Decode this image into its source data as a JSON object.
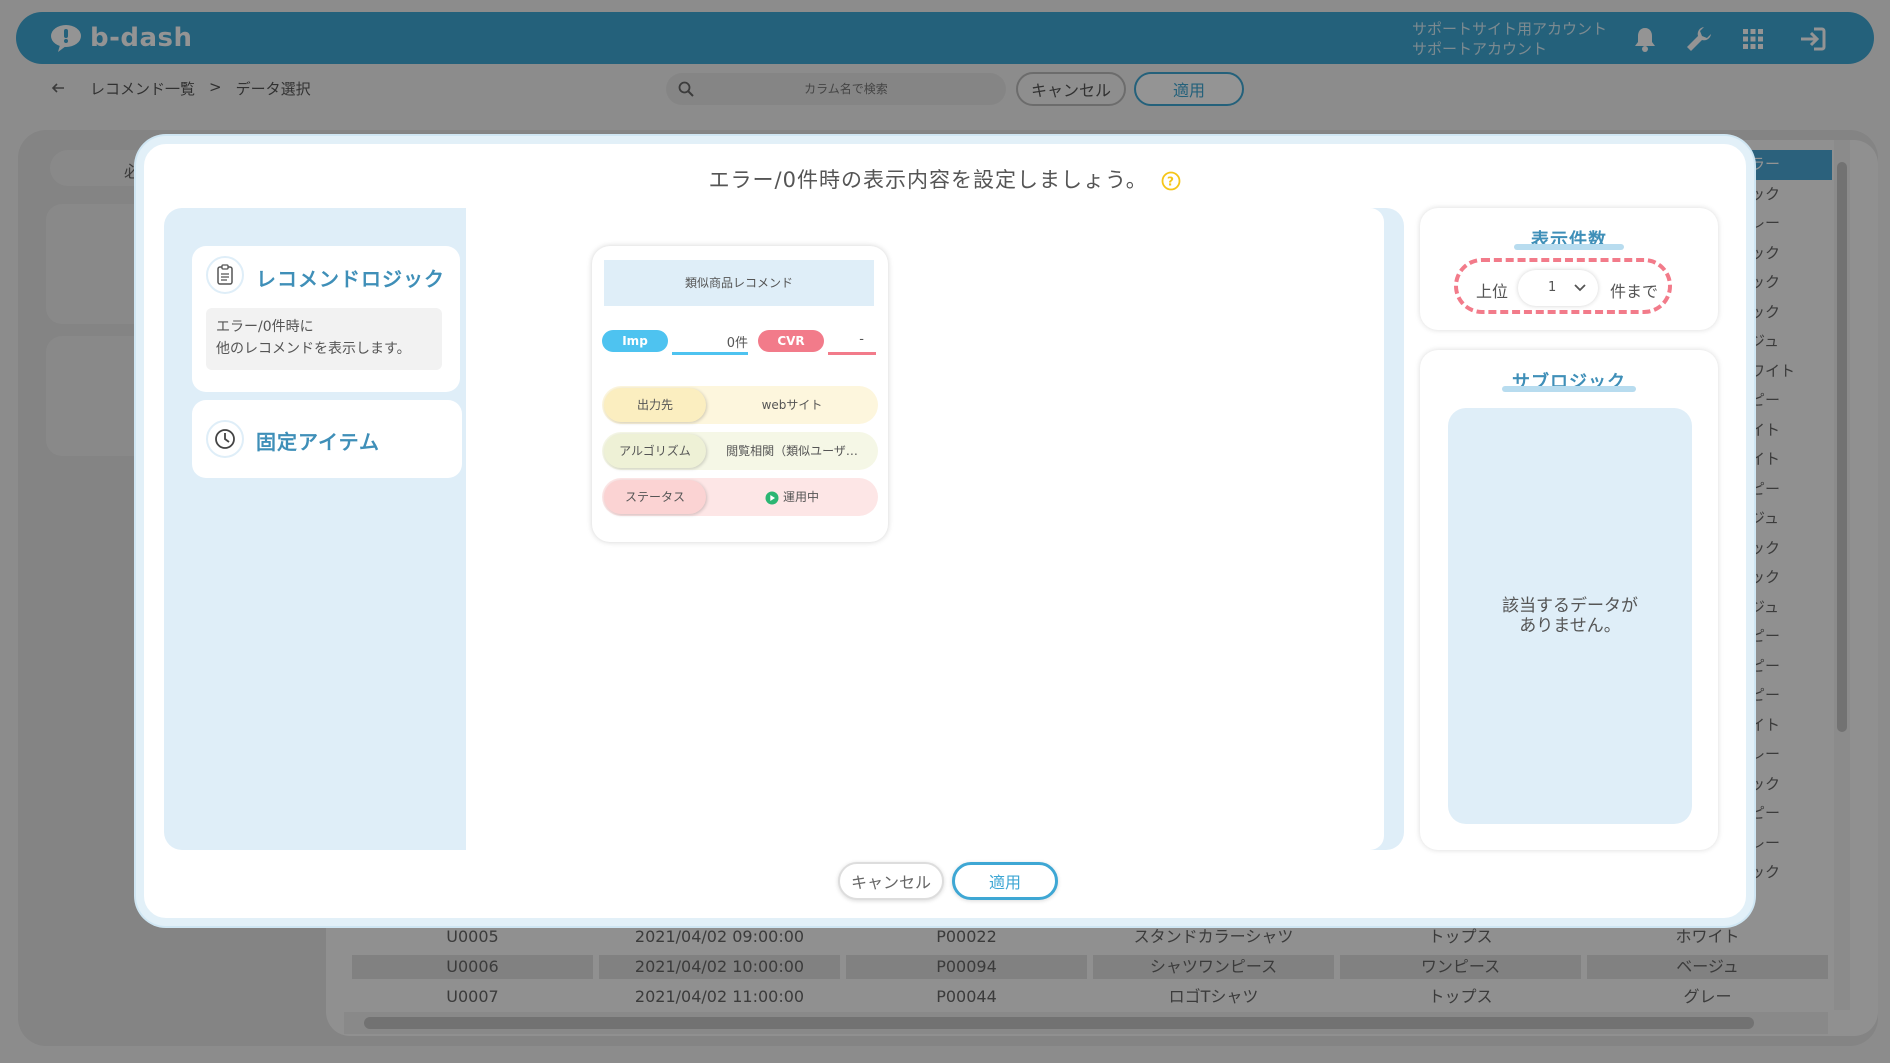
{
  "header": {
    "logo_text": "b-dash",
    "account_line1": "サポートサイト用アカウント",
    "account_line2": "サポートアカウント"
  },
  "toolbar": {
    "breadcrumb_parent": "レコメンド一覧",
    "breadcrumb_sep": ">",
    "breadcrumb_current": "データ選択",
    "search_placeholder": "カラム名で検索",
    "cancel_label": "キャンセル",
    "apply_label": "適用"
  },
  "background": {
    "left_tab_partial": "必",
    "right_column_values": [
      "ラー",
      "ック",
      "レー",
      "ック",
      "ック",
      "ック",
      "ジュ",
      "ワイト",
      "ピー",
      "イト",
      "イト",
      "ピー",
      "ジュ",
      "ック",
      "ック",
      "ジュ",
      "ピー",
      "ピー",
      "ピー",
      "イト",
      "レー",
      "ック",
      "ピー",
      "レー",
      "ック"
    ],
    "table_rows": [
      [
        "U0005",
        "2021/04/02 09:00:00",
        "P00022",
        "スタンドカラーシャツ",
        "トップス",
        "ホワイト"
      ],
      [
        "U0006",
        "2021/04/02 10:00:00",
        "P00094",
        "シャツワンピース",
        "ワンピース",
        "ベージュ"
      ],
      [
        "U0007",
        "2021/04/02 11:00:00",
        "P00044",
        "ロゴTシャツ",
        "トップス",
        "グレー"
      ]
    ]
  },
  "modal": {
    "title": "エラー/0件時の表示内容を設定しましょう。",
    "logic_card": {
      "title": "レコメンドロジック",
      "desc_line1": "エラー/0件時に",
      "desc_line2": "他のレコメンドを表示します。"
    },
    "fixed_card": {
      "title": "固定アイテム"
    },
    "reco_card": {
      "name": "類似商品レコメンド",
      "imp_label": "Imp",
      "imp_value": "0件",
      "cvr_label": "CVR",
      "cvr_value": "-",
      "output_label": "出力先",
      "output_value": "webサイト",
      "algorithm_label": "アルゴリズム",
      "algorithm_value": "閲覧相関（類似ユーザ…",
      "status_label": "ステータス",
      "status_value": "運用中"
    },
    "count_panel": {
      "title": "表示件数",
      "prefix": "上位",
      "selected": "1",
      "suffix": "件まで"
    },
    "sub_panel": {
      "title": "サブロジック",
      "empty_line1": "該当するデータが",
      "empty_line2": "ありません。"
    },
    "cancel_label": "キャンセル",
    "apply_label": "適用"
  },
  "colors": {
    "brand": "#3ea7d4",
    "imp": "#4ec3f0",
    "cvr": "#f27b8a",
    "status_running": "#2bb673"
  },
  "icons": [
    "bell-icon",
    "wrench-icon",
    "grid-icon",
    "logout-icon",
    "back-arrow-icon",
    "search-icon",
    "help-icon",
    "document-icon",
    "clock-icon",
    "play-icon",
    "chevron-down-icon"
  ]
}
